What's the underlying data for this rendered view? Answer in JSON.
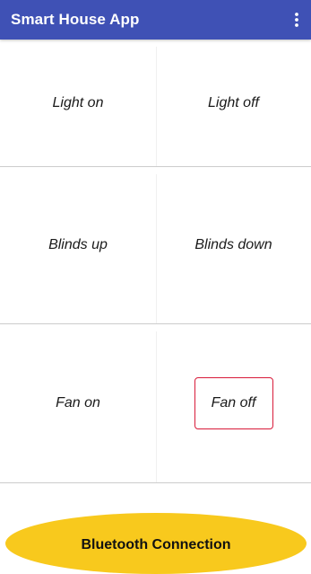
{
  "appbar": {
    "title": "Smart House App",
    "menu_icon": "more-vert-icon",
    "color": "#3f51b5"
  },
  "controls": {
    "light_on": "Light on",
    "light_off": "Light off",
    "blinds_up": "Blinds up",
    "blinds_down": "Blinds down",
    "fan_on": "Fan on",
    "fan_off": "Fan off"
  },
  "selected_control": "fan_off",
  "selection_color": "#d81b3a",
  "bluetooth": {
    "label": "Bluetooth Connection",
    "color": "#f8c91d"
  }
}
